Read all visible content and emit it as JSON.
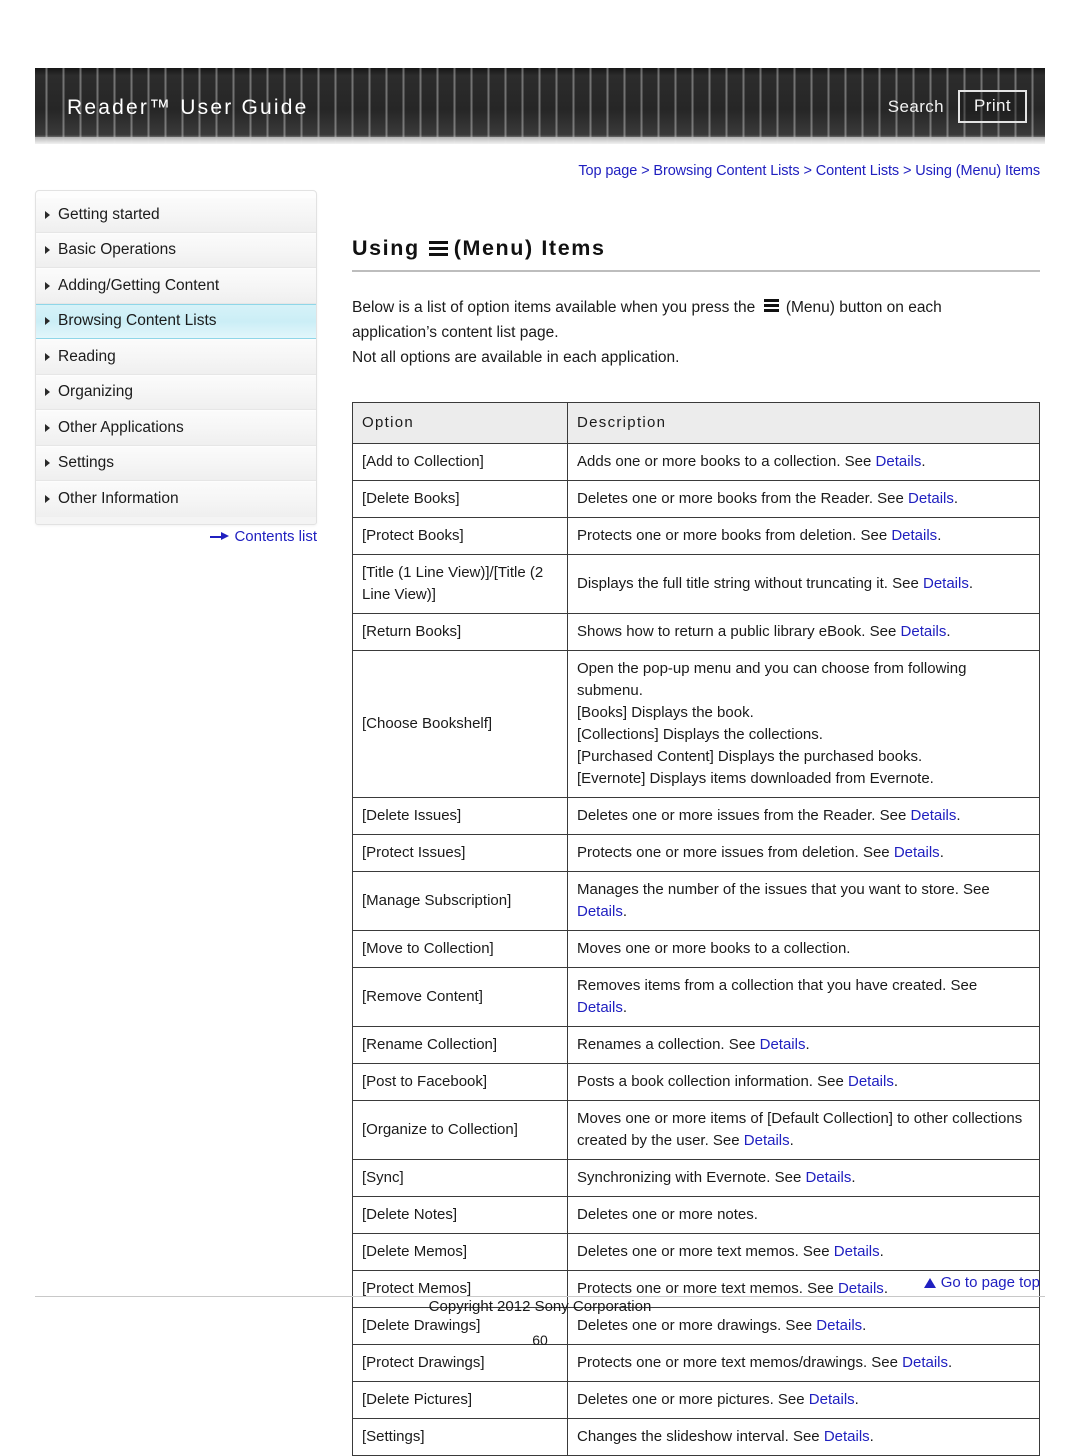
{
  "header": {
    "title": "Reader™ User Guide",
    "search_label": "Search",
    "print_label": "Print"
  },
  "breadcrumb": {
    "text": "Top page > Browsing Content Lists > Content Lists > Using (Menu) Items"
  },
  "sidebar": {
    "items": [
      {
        "label": "Getting started",
        "active": false
      },
      {
        "label": "Basic Operations",
        "active": false
      },
      {
        "label": "Adding/Getting Content",
        "active": false
      },
      {
        "label": "Browsing Content Lists",
        "active": true
      },
      {
        "label": "Reading",
        "active": false
      },
      {
        "label": "Organizing",
        "active": false
      },
      {
        "label": "Other Applications",
        "active": false
      },
      {
        "label": "Settings",
        "active": false
      },
      {
        "label": "Other Information",
        "active": false
      }
    ],
    "contents_list_label": "Contents list"
  },
  "main": {
    "title_prefix": "Using",
    "title_suffix": "(Menu) Items",
    "intro_line1_before": "Below is a list of option items available when you press the",
    "intro_line1_after": "(Menu) button on each",
    "intro_line2": "application’s content list page.",
    "intro_line3": "Not all options are available in each application.",
    "table": {
      "headers": [
        "Option",
        "Description"
      ],
      "rows": [
        {
          "option": "[Add to Collection]",
          "lines": [
            {
              "text": "Adds one or more books to a collection. See ",
              "link": "Details",
              "tail": "."
            }
          ]
        },
        {
          "option": "[Delete Books]",
          "lines": [
            {
              "text": "Deletes one or more books from the Reader. See ",
              "link": "Details",
              "tail": "."
            }
          ]
        },
        {
          "option": "[Protect Books]",
          "lines": [
            {
              "text": "Protects one or more books from deletion. See ",
              "link": "Details",
              "tail": "."
            }
          ]
        },
        {
          "option": "[Title (1 Line View)]/[Title (2 Line View)]",
          "lines": [
            {
              "text": "Displays the full title string without truncating it. See ",
              "link": "Details",
              "tail": "."
            }
          ]
        },
        {
          "option": "[Return Books]",
          "lines": [
            {
              "text": "Shows how to return a public library eBook. See ",
              "link": "Details",
              "tail": "."
            }
          ]
        },
        {
          "option": "[Choose Bookshelf]",
          "lines": [
            {
              "text": "Open the pop-up menu and you can choose from following",
              "link": "",
              "tail": ""
            },
            {
              "text": "submenu.",
              "link": "",
              "tail": ""
            },
            {
              "text": "[Books] Displays the book.",
              "link": "",
              "tail": ""
            },
            {
              "text": "[Collections] Displays the collections.",
              "link": "",
              "tail": ""
            },
            {
              "text": "[Purchased Content] Displays the purchased books.",
              "link": "",
              "tail": ""
            },
            {
              "text": "[Evernote] Displays items downloaded from Evernote.",
              "link": "",
              "tail": ""
            }
          ]
        },
        {
          "option": "[Delete Issues]",
          "lines": [
            {
              "text": "Deletes one or more issues from the Reader. See ",
              "link": "Details",
              "tail": "."
            }
          ]
        },
        {
          "option": "[Protect Issues]",
          "lines": [
            {
              "text": "Protects one or more issues from deletion. See ",
              "link": "Details",
              "tail": "."
            }
          ]
        },
        {
          "option": "[Manage Subscription]",
          "lines": [
            {
              "text": "Manages the number of the issues that you want to store. See",
              "link": "",
              "tail": ""
            },
            {
              "text": "",
              "link": "Details",
              "tail": "."
            }
          ]
        },
        {
          "option": "[Move to Collection]",
          "lines": [
            {
              "text": "Moves one or more books to a collection.",
              "link": "",
              "tail": ""
            }
          ]
        },
        {
          "option": "[Remove Content]",
          "lines": [
            {
              "text": "Removes items from a collection that you have created. See",
              "link": "",
              "tail": ""
            },
            {
              "text": "",
              "link": "Details",
              "tail": "."
            }
          ]
        },
        {
          "option": "[Rename Collection]",
          "lines": [
            {
              "text": "Renames a collection. See ",
              "link": "Details",
              "tail": "."
            }
          ]
        },
        {
          "option": "[Post to Facebook]",
          "lines": [
            {
              "text": "Posts a book collection information. See ",
              "link": "Details",
              "tail": "."
            }
          ]
        },
        {
          "option": "[Organize to Collection]",
          "lines": [
            {
              "text": "Moves one or more items of [Default Collection] to other collections",
              "link": "",
              "tail": ""
            },
            {
              "text": "created by the user. See ",
              "link": "Details",
              "tail": "."
            }
          ]
        },
        {
          "option": "[Sync]",
          "lines": [
            {
              "text": "Synchronizing with Evernote. See ",
              "link": "Details",
              "tail": "."
            }
          ]
        },
        {
          "option": "[Delete Notes]",
          "lines": [
            {
              "text": "Deletes one or more notes.",
              "link": "",
              "tail": ""
            }
          ]
        },
        {
          "option": "[Delete Memos]",
          "lines": [
            {
              "text": "Deletes one or more text memos. See ",
              "link": "Details",
              "tail": "."
            }
          ]
        },
        {
          "option": "[Protect Memos]",
          "lines": [
            {
              "text": "Protects one or more text memos. See ",
              "link": "Details",
              "tail": "."
            }
          ]
        },
        {
          "option": "[Delete Drawings]",
          "lines": [
            {
              "text": "Deletes one or more drawings. See ",
              "link": "Details",
              "tail": "."
            }
          ]
        },
        {
          "option": "[Protect Drawings]",
          "lines": [
            {
              "text": "Protects one or more text memos/drawings. See ",
              "link": "Details",
              "tail": "."
            }
          ]
        },
        {
          "option": "[Delete Pictures]",
          "lines": [
            {
              "text": "Deletes one or more pictures. See ",
              "link": "Details",
              "tail": "."
            }
          ]
        },
        {
          "option": "[Settings]",
          "lines": [
            {
              "text": "Changes the slideshow interval. See ",
              "link": "Details",
              "tail": "."
            }
          ]
        }
      ]
    }
  },
  "footer": {
    "go_to_top_label": "Go to page top",
    "copyright": "Copyright 2012 Sony Corporation",
    "page_number": "60"
  },
  "colors": {
    "link": "#2020c0",
    "active_nav_bg": "#cbeef6",
    "active_nav_border": "#8fd6e8",
    "table_border": "#3a3a3a",
    "table_header_bg": "#ececec"
  }
}
